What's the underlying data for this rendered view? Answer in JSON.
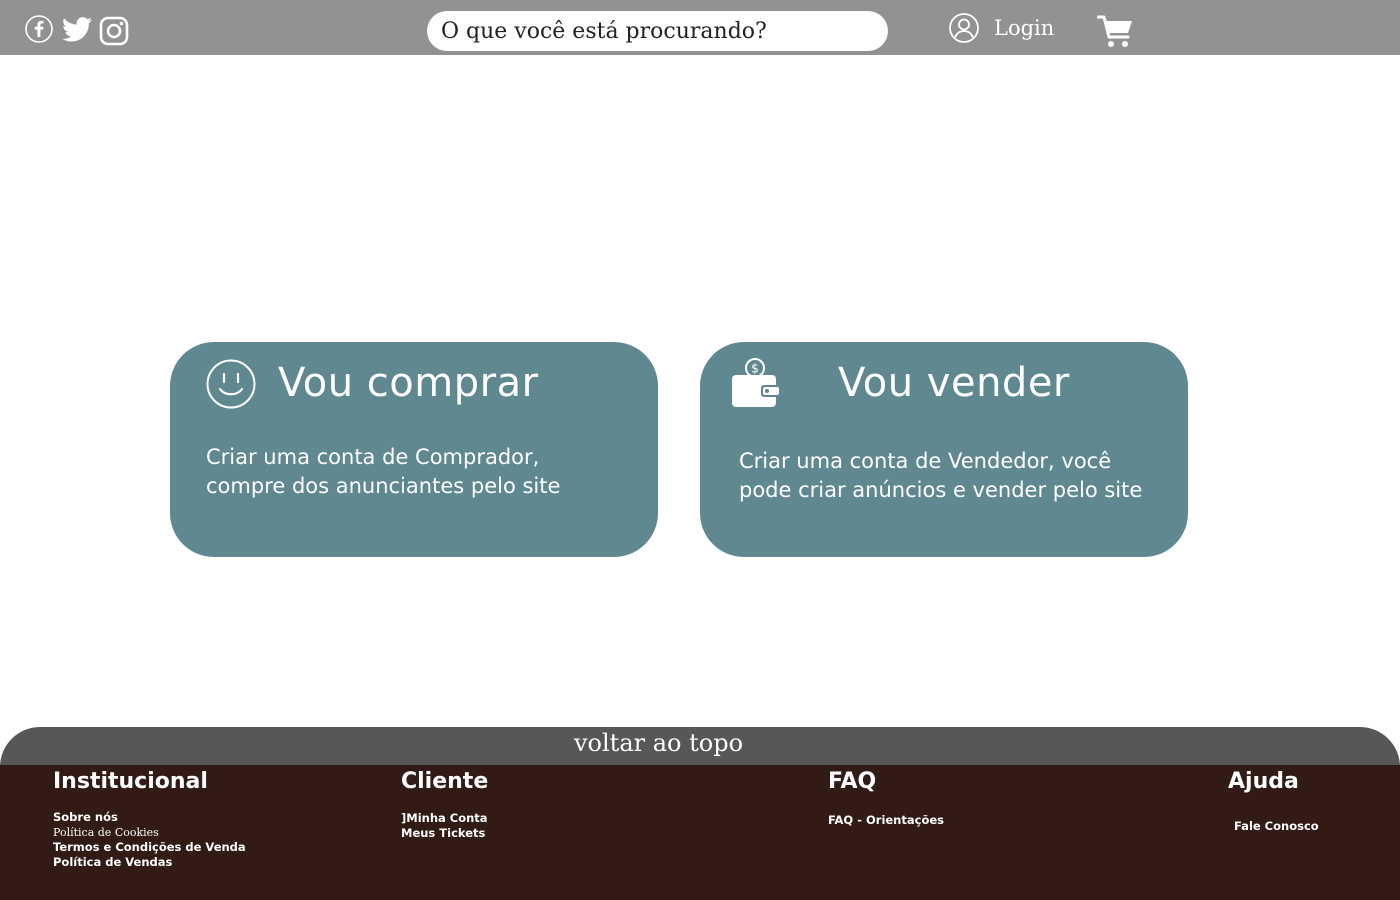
{
  "header": {
    "social": [
      "facebook-icon",
      "twitter-icon",
      "instagram-icon"
    ],
    "search": {
      "placeholder": "O que você está procurando?"
    },
    "login_label": "Login",
    "cart_icon": "cart-icon"
  },
  "cards": {
    "buy": {
      "title": "Vou comprar",
      "desc_line1": "Criar uma conta de Comprador,",
      "desc_line2": "compre dos anunciantes pelo site",
      "icon": "smiley-icon"
    },
    "sell": {
      "title": "Vou vender",
      "desc_line1": "Criar uma conta de Vendedor, você",
      "desc_line2": "pode criar anúncios e vender pelo site",
      "icon": "wallet-icon"
    }
  },
  "footer": {
    "back_to_top": "voltar ao topo",
    "institucional": {
      "title": "Institucional",
      "links": [
        "Sobre nós",
        "Política de Cookies",
        "Termos e Condições de Venda",
        "Política de Vendas"
      ]
    },
    "cliente": {
      "title": "Cliente",
      "links": [
        "]Minha Conta",
        "Meus Tickets"
      ]
    },
    "faq": {
      "title": "FAQ",
      "links": [
        "FAQ - Orientações"
      ]
    },
    "ajuda": {
      "title": "Ajuda",
      "links": [
        "Fale Conosco"
      ]
    }
  },
  "colors": {
    "header_bg": "#929292",
    "card_bg": "#5f8891",
    "back_top_bg": "#575757",
    "footer_bg": "#321b14"
  }
}
